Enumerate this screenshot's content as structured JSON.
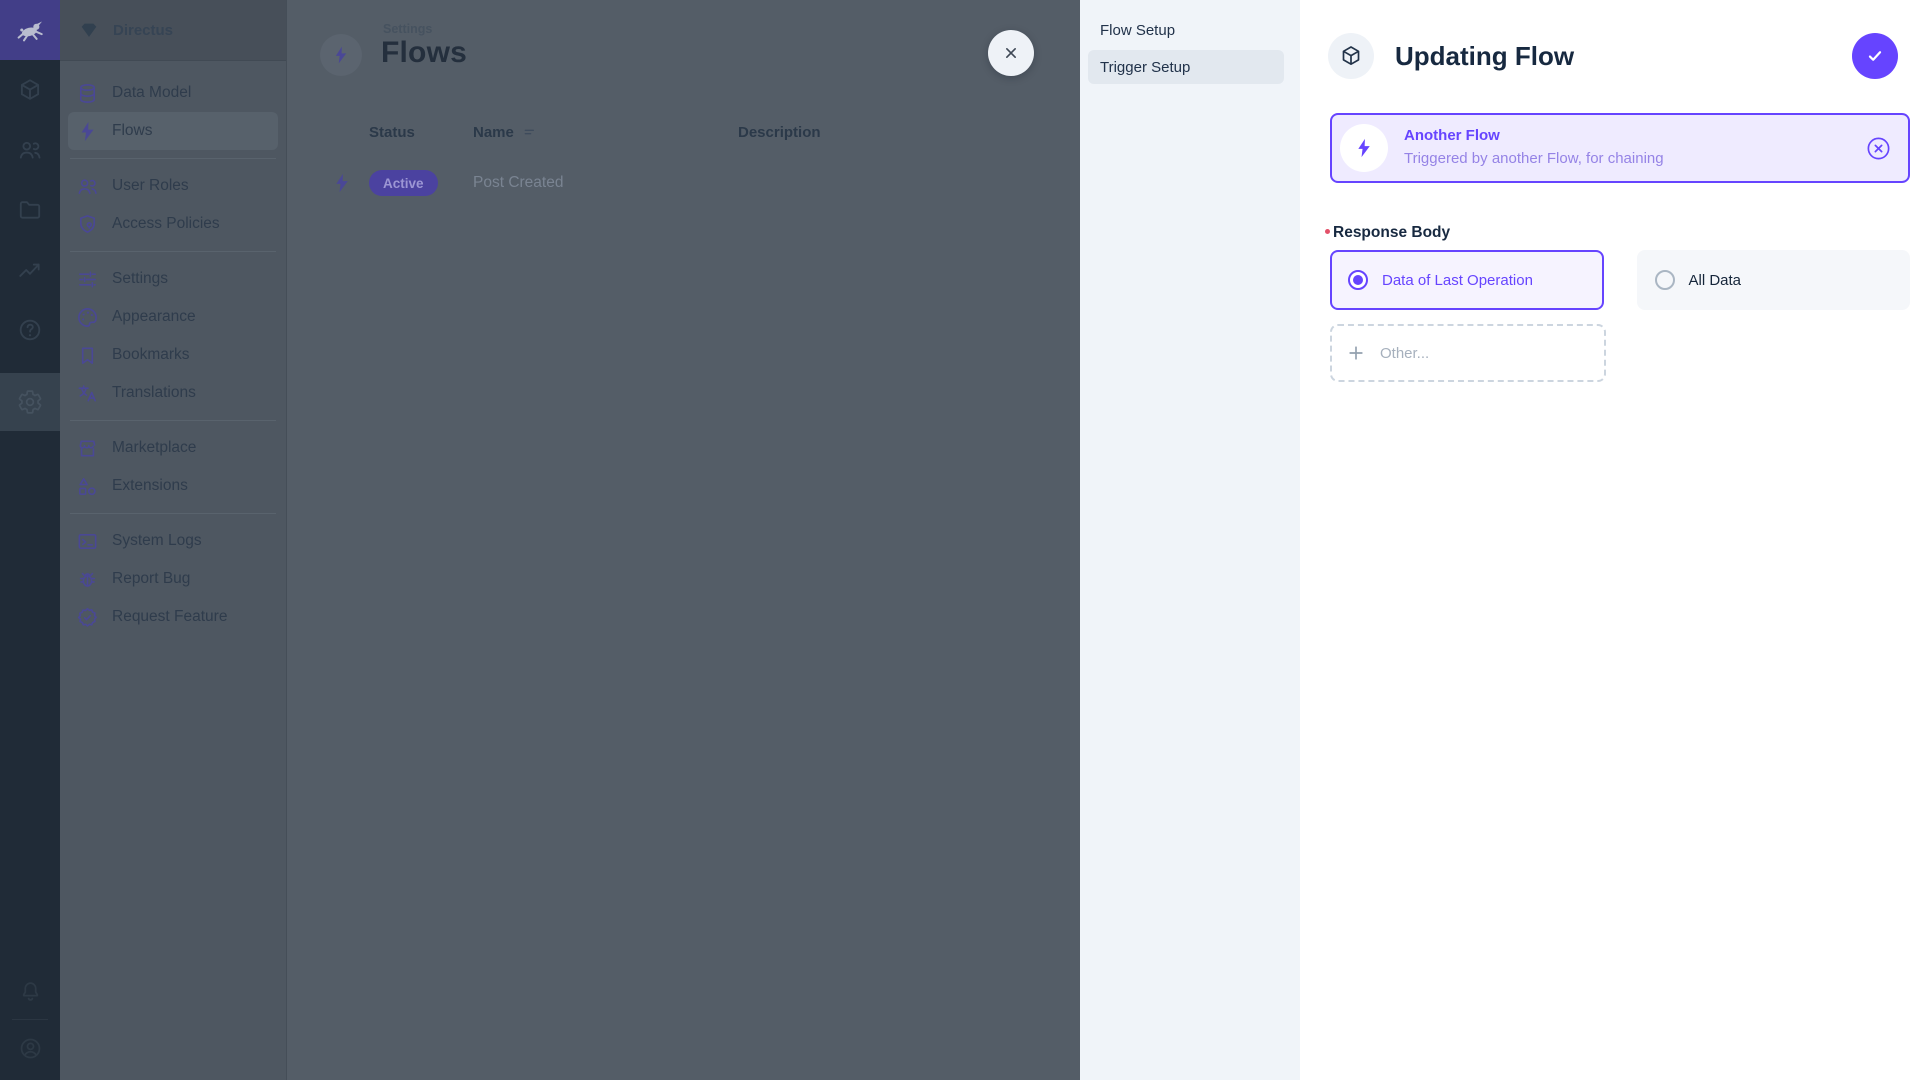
{
  "colors": {
    "accent": "#6644ff",
    "accent_light": "#efebff",
    "danger": "#e35169"
  },
  "module_bar": {
    "logo_icon": "directus-rabbit-logo",
    "items": [
      {
        "icon": "content-cube-icon"
      },
      {
        "icon": "users-icon"
      },
      {
        "icon": "files-folder-icon"
      },
      {
        "icon": "insights-chart-icon"
      },
      {
        "icon": "help-icon"
      },
      {
        "icon": "settings-gear-icon",
        "active": true
      }
    ],
    "bottom": [
      {
        "icon": "notifications-bell-icon"
      },
      {
        "icon": "account-icon"
      }
    ]
  },
  "nav": {
    "project_name": "Directus",
    "project_icon": "project-diamond-icon",
    "groups": [
      {
        "items": [
          {
            "label": "Data Model",
            "icon": "database-icon"
          },
          {
            "label": "Flows",
            "icon": "bolt-icon",
            "active": true
          }
        ]
      },
      {
        "items": [
          {
            "label": "User Roles",
            "icon": "user-roles-icon"
          },
          {
            "label": "Access Policies",
            "icon": "shield-icon"
          }
        ]
      },
      {
        "items": [
          {
            "label": "Settings",
            "icon": "tune-sliders-icon"
          },
          {
            "label": "Appearance",
            "icon": "palette-icon"
          },
          {
            "label": "Bookmarks",
            "icon": "bookmark-icon"
          },
          {
            "label": "Translations",
            "icon": "translate-icon"
          }
        ]
      },
      {
        "items": [
          {
            "label": "Marketplace",
            "icon": "storefront-icon"
          },
          {
            "label": "Extensions",
            "icon": "shapes-icon"
          }
        ]
      },
      {
        "items": [
          {
            "label": "System Logs",
            "icon": "terminal-icon"
          },
          {
            "label": "Report Bug",
            "icon": "bug-icon"
          },
          {
            "label": "Request Feature",
            "icon": "feature-badge-icon"
          }
        ]
      }
    ]
  },
  "main": {
    "breadcrumb": "Settings",
    "title": "Flows",
    "table": {
      "headers": [
        "Status",
        "Name",
        "Description"
      ],
      "rows": [
        {
          "status": "Active",
          "name": "Post Created",
          "description": ""
        }
      ]
    }
  },
  "drawer": {
    "nav_items": [
      {
        "label": "Flow Setup"
      },
      {
        "label": "Trigger Setup",
        "active": true
      }
    ],
    "title": "Updating Flow",
    "trigger_card": {
      "title": "Another Flow",
      "subtitle": "Triggered by another Flow, for chaining"
    },
    "response_body": {
      "label": "Response Body",
      "required": true,
      "options": [
        {
          "label": "Data of Last Operation",
          "selected": true
        },
        {
          "label": "All Data",
          "selected": false
        }
      ],
      "other_label": "Other..."
    }
  }
}
